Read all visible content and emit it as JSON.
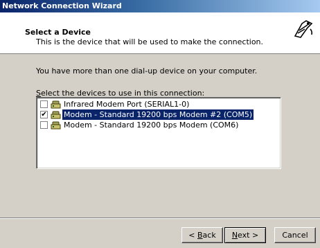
{
  "window": {
    "title": "Network Connection Wizard"
  },
  "header": {
    "title": "Select a Device",
    "subtitle": "This is the device that will be used to make the connection."
  },
  "body": {
    "message": "You have more than one dial-up device on your computer.",
    "list_label_prefix": "",
    "list_label_accel": "S",
    "list_label_rest": "elect the devices to use in this connection:"
  },
  "devices": [
    {
      "label": "Infrared Modem Port (SERIAL1-0)",
      "checked": false,
      "selected": false,
      "icon": "modem-icon"
    },
    {
      "label": "Modem - Standard 19200 bps Modem #2 (COM5)",
      "checked": true,
      "selected": true,
      "icon": "modem-icon"
    },
    {
      "label": "Modem - Standard 19200 bps Modem (COM6)",
      "checked": false,
      "selected": false,
      "icon": "modem-icon"
    }
  ],
  "buttons": {
    "back_prefix": "< ",
    "back_accel": "B",
    "back_rest": "ack",
    "next_accel": "N",
    "next_rest": "ext >",
    "cancel": "Cancel"
  },
  "colors": {
    "title_bar": "#0a246a",
    "selection": "#0a246a",
    "face": "#d4d0c8"
  }
}
